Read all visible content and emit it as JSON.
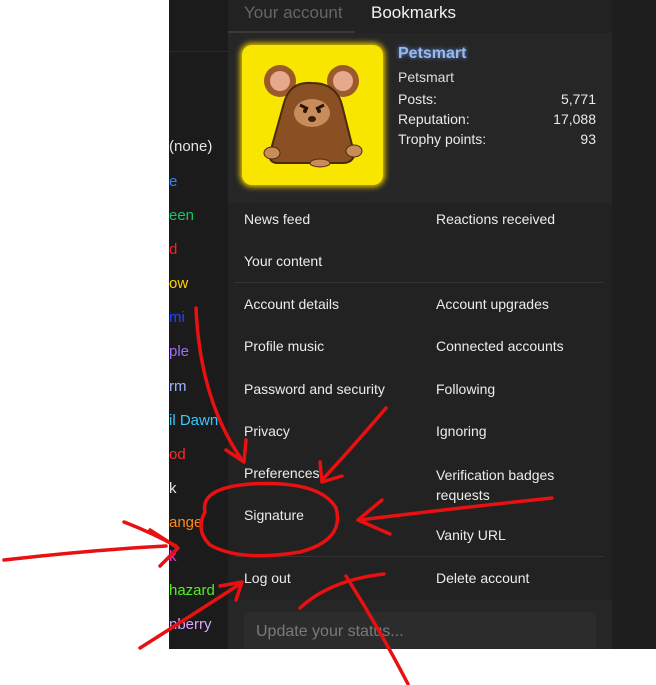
{
  "style_list": [
    {
      "label": "(none)",
      "color": "#e6e6e6"
    },
    {
      "label": "e",
      "color": "#2e86ff"
    },
    {
      "label": "een",
      "color": "#19c46a"
    },
    {
      "label": "d",
      "color": "#ff2020"
    },
    {
      "label": "ow",
      "color": "#ffd000"
    },
    {
      "label": "mi",
      "color": "#2244ff"
    },
    {
      "label": "ple",
      "color": "#a06bff"
    },
    {
      "label": "rm",
      "color": "#9fb3ff"
    },
    {
      "label": "il Dawn",
      "color": "#38c7ff"
    },
    {
      "label": "od",
      "color": "#ff2a2a"
    },
    {
      "label": "k",
      "color": "#e6e6e6"
    },
    {
      "label": "ange",
      "color": "#ff8a1a"
    },
    {
      "label": "k",
      "color": "#ff33cc"
    },
    {
      "label": "hazard",
      "color": "#55ee22"
    },
    {
      "label": "nberry",
      "color": "#d8a6ff"
    }
  ],
  "menu": {
    "tabs": {
      "your_account": "Your account",
      "bookmarks": "Bookmarks"
    },
    "profile": {
      "username": "Petsmart",
      "title": "Petsmart",
      "stats": [
        {
          "label": "Posts:",
          "value": "5,771"
        },
        {
          "label": "Reputation:",
          "value": "17,088"
        },
        {
          "label": "Trophy points:",
          "value": "93"
        }
      ]
    },
    "links": {
      "news_feed": "News feed",
      "reactions_received": "Reactions received",
      "your_content": "Your content",
      "account_details": "Account details",
      "account_upgrades": "Account upgrades",
      "profile_music": "Profile music",
      "connected_accounts": "Connected accounts",
      "password_security": "Password and security",
      "following": "Following",
      "privacy": "Privacy",
      "ignoring": "Ignoring",
      "preferences": "Preferences",
      "verification_badges_l1": "Verification badges",
      "verification_badges_l2": "requests",
      "signature": "Signature",
      "vanity_url": "Vanity URL",
      "log_out": "Log out",
      "delete_account": "Delete account"
    },
    "status_placeholder": "Update your status..."
  },
  "colors": {
    "annotation_red": "#e81010",
    "avatar_bg": "#f8e600",
    "username": "#9bb9ea"
  }
}
